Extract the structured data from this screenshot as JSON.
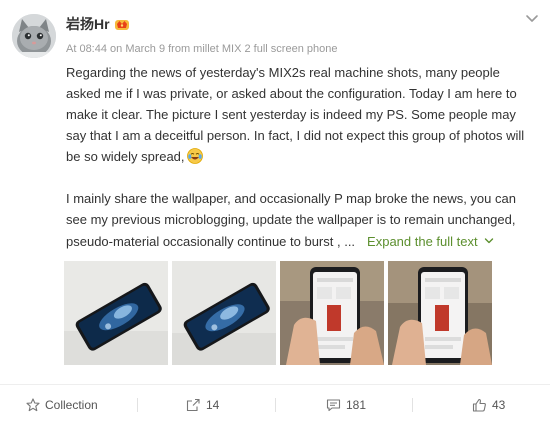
{
  "post": {
    "username": "岩扬Hr",
    "meta": "At 08:44 on March 9 from millet MIX 2 full screen phone",
    "paragraph1": "Regarding the news of yesterday's MIX2s real machine shots, many people asked me if I was private, or asked about the configuration. Today I am here to make it clear. The picture I sent yesterday is indeed my PS. Some people may say that I am a deceitful person. In fact, I did not expect this group of photos will be so widely spread,",
    "paragraph2": "I mainly share the wallpaper, and occasionally P map broke the news, you can see my previous microblogging, update the wallpaper is to remain unchanged, pseudo-material occasionally continue to burst , ...",
    "expand_label": "Expand the full text",
    "emoji": "laughing-crying-emoji",
    "images": [
      {
        "subject": "phone-on-table"
      },
      {
        "subject": "phone-on-table"
      },
      {
        "subject": "hand-holding-phone"
      },
      {
        "subject": "hand-holding-phone"
      }
    ]
  },
  "actions": {
    "collection_label": "Collection",
    "share_count": "14",
    "comment_count": "181",
    "like_count": "43"
  },
  "colors": {
    "link_green": "#5c8f2e",
    "meta_gray": "#9a9a9a",
    "text": "#333333"
  },
  "icons": [
    "star-icon",
    "share-icon",
    "comment-icon",
    "thumbs-up-icon",
    "chevron-down-icon",
    "vip-crown-icon"
  ]
}
